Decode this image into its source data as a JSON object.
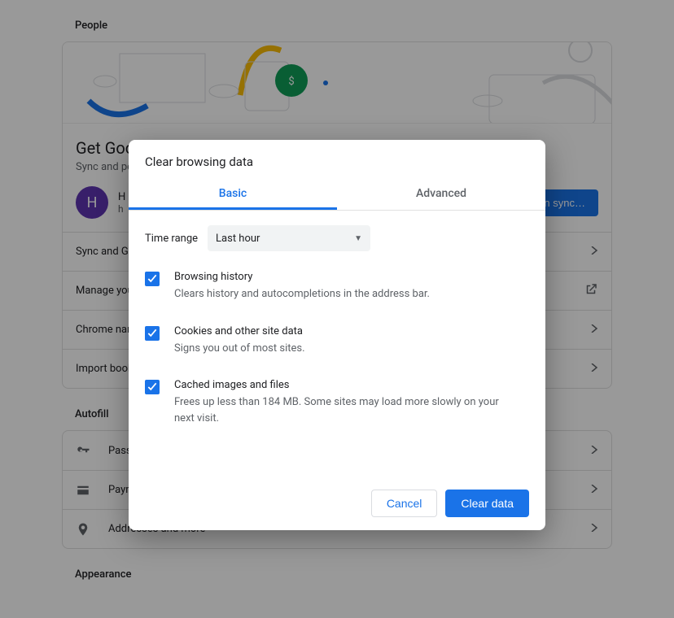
{
  "sections": {
    "people": "People",
    "autofill": "Autofill",
    "appearance": "Appearance"
  },
  "getSmarts": {
    "title": "Get Google smarts in Chrome",
    "sub": "Sync and personalize Chrome across your devices"
  },
  "profile": {
    "initial": "H",
    "name": "H",
    "email": "h",
    "syncBtn": "Turn on sync…"
  },
  "peopleRows": {
    "sync": "Sync and Google services",
    "manage": "Manage your Google Account",
    "chromeName": "Chrome name and picture",
    "import": "Import bookmarks and settings"
  },
  "autofillRows": {
    "passwords": "Passwords",
    "payment": "Payment methods",
    "addresses": "Addresses and more"
  },
  "modal": {
    "title": "Clear browsing data",
    "tabs": {
      "basic": "Basic",
      "advanced": "Advanced"
    },
    "timeRangeLabel": "Time range",
    "timeRangeValue": "Last hour",
    "opts": {
      "history": {
        "title": "Browsing history",
        "sub": "Clears history and autocompletions in the address bar."
      },
      "cookies": {
        "title": "Cookies and other site data",
        "sub": "Signs you out of most sites."
      },
      "cache": {
        "title": "Cached images and files",
        "sub": "Frees up less than 184 MB. Some sites may load more slowly on your next visit."
      }
    },
    "buttons": {
      "cancel": "Cancel",
      "clear": "Clear data"
    }
  },
  "colors": {
    "primary": "#1a73e8"
  }
}
